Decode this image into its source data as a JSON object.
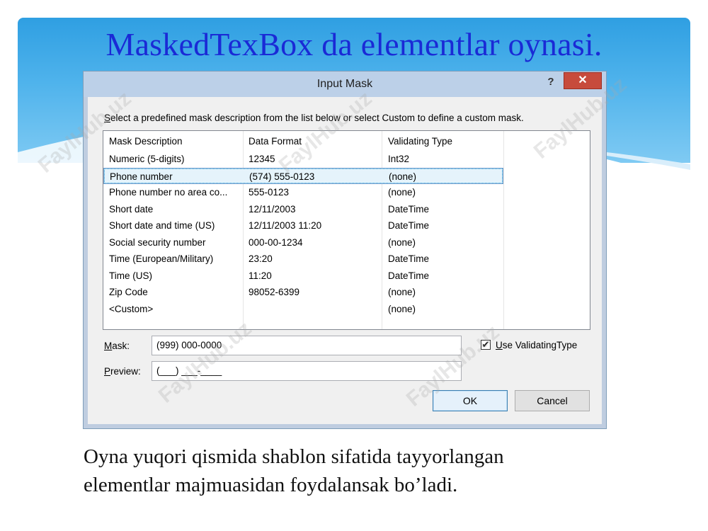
{
  "slide": {
    "title": "MaskedTexBox da elementlar oynasi.",
    "caption_line1": "Oyna yuqori qismida shablon sifatida tayyorlangan",
    "caption_line2": "elementlar majmuasidan foydalansak bo’ladi.",
    "watermark": "FaylHub.uz"
  },
  "dialog": {
    "title": "Input Mask",
    "help": "?",
    "close": "✕",
    "instruction_first": "S",
    "instruction_rest": "elect a predefined mask description from the list below or select Custom to define a custom mask.",
    "columns": [
      "Mask Description",
      "Data Format",
      "Validating Type"
    ],
    "rows": [
      [
        "Numeric (5-digits)",
        "12345",
        "Int32"
      ],
      [
        "Phone number",
        "(574) 555-0123",
        "(none)"
      ],
      [
        "Phone number no area co...",
        "555-0123",
        "(none)"
      ],
      [
        "Short date",
        "12/11/2003",
        "DateTime"
      ],
      [
        "Short date and time (US)",
        "12/11/2003 11:20",
        "DateTime"
      ],
      [
        "Social security number",
        "000-00-1234",
        "(none)"
      ],
      [
        "Time (European/Military)",
        "23:20",
        "DateTime"
      ],
      [
        "Time (US)",
        "11:20",
        "DateTime"
      ],
      [
        "Zip Code",
        "98052-6399",
        "(none)"
      ],
      [
        "<Custom>",
        "",
        "(none)"
      ]
    ],
    "selected_row": 1,
    "mask_label_first": "M",
    "mask_label_rest": "ask:",
    "mask_value": "(999) 000-0000",
    "preview_label_first": "P",
    "preview_label_rest": "review:",
    "preview_value": "(___) ___-____",
    "use_validating_first": "U",
    "use_validating_rest": "se ValidatingType",
    "use_validating_checked": true,
    "check_mark": "✔",
    "ok_label": "OK",
    "cancel_label": "Cancel"
  },
  "colors": {
    "title": "#1a2ad6",
    "banner": "#2f9fe2",
    "close": "#c74b3c"
  }
}
